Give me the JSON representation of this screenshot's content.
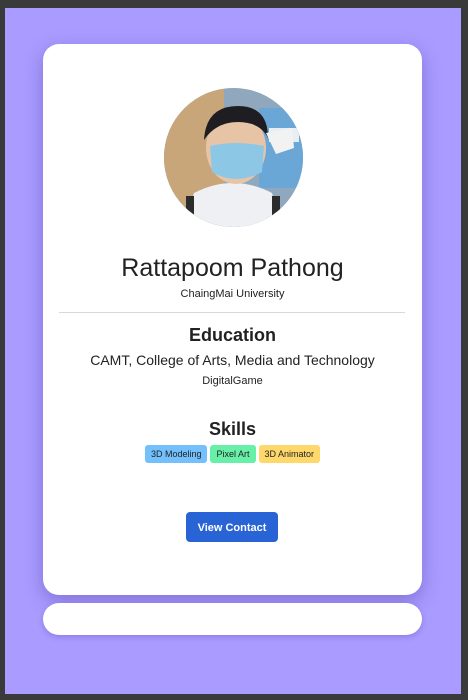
{
  "profile": {
    "name": "Rattapoom Pathong",
    "university": "ChaingMai University"
  },
  "education": {
    "title": "Education",
    "college": "CAMT, College of Arts, Media and Technology",
    "major": "DigitalGame"
  },
  "skills": {
    "title": "Skills",
    "items": [
      {
        "label": "3D Modeling",
        "color": "#74c0fc"
      },
      {
        "label": "Pixel Art",
        "color": "#69f0a8"
      },
      {
        "label": "3D Animator",
        "color": "#ffd86b"
      }
    ]
  },
  "actions": {
    "contact_label": "View Contact"
  },
  "colors": {
    "background": "#a99bff",
    "button": "#2864d6"
  }
}
